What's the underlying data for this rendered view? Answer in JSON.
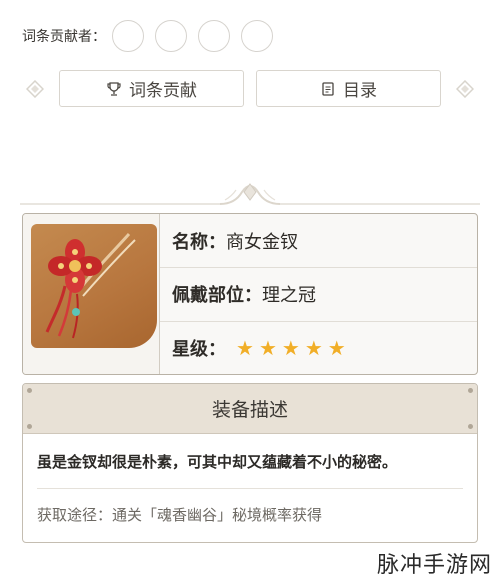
{
  "contributors": {
    "label": "词条贡献者：",
    "slot_count": 4
  },
  "nav": {
    "contribute_label": "词条贡献",
    "contribute_icon": "trophy-icon",
    "toc_label": "目录",
    "toc_icon": "document-icon"
  },
  "item": {
    "name_key": "名称：",
    "name_value": "商女金钗",
    "slot_key": "佩戴部位：",
    "slot_value": "理之冠",
    "rarity_key": "星级：",
    "rarity_stars": 5,
    "star_color": "#f1ae27"
  },
  "description": {
    "title": "装备描述",
    "text": "虽是金钗却很是朴素，可其中却又蕴藏着不小的秘密。",
    "source": "获取途径：通关「魂香幽谷」秘境概率获得"
  },
  "watermark": "脉冲手游网"
}
